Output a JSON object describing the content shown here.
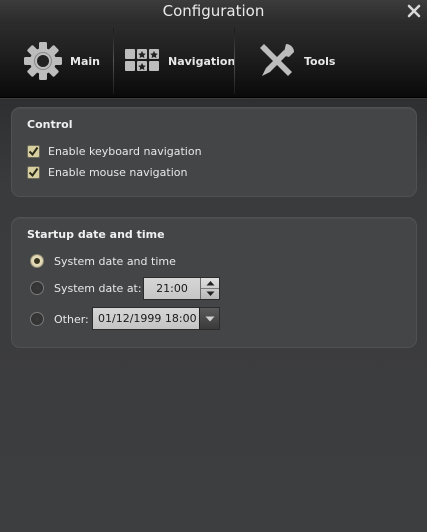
{
  "window": {
    "title": "Configuration",
    "close_icon": "close-icon"
  },
  "toolbar": {
    "items": [
      {
        "label": "Main",
        "icon": "gear-icon"
      },
      {
        "label": "Navigation",
        "icon": "keys-icon"
      },
      {
        "label": "Tools",
        "icon": "tools-icon"
      }
    ]
  },
  "control": {
    "title": "Control",
    "keyboard_label": "Enable keyboard navigation",
    "keyboard_checked": true,
    "mouse_label": "Enable mouse navigation",
    "mouse_checked": true
  },
  "startup": {
    "title": "Startup date and time",
    "option_system": "System date and time",
    "option_system_at": "System date at:",
    "time_value": "21:00",
    "option_other": "Other:",
    "other_value": "01/12/1999 18:00",
    "selected": "System date and time"
  },
  "colors": {
    "accent_check": "#d8cfa0",
    "background": "#3a3b3d",
    "panel": "#444547"
  }
}
